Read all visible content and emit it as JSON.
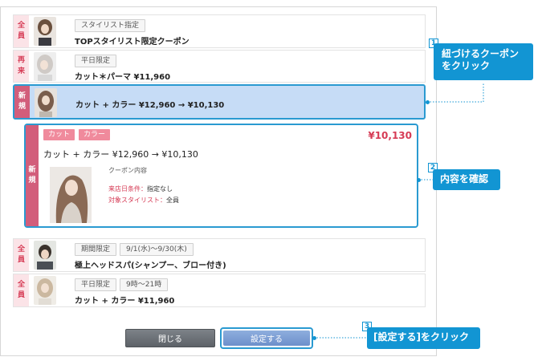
{
  "coupons": [
    {
      "badge": [
        "全",
        "員"
      ],
      "chips": [
        "スタイリスト指定"
      ],
      "title": "TOPスタイリスト限定クーポン"
    },
    {
      "badge": [
        "再",
        "来"
      ],
      "chips": [
        "平日限定"
      ],
      "title": "カット＊パーマ ¥11,960"
    },
    {
      "badge": [
        "新",
        "規"
      ],
      "chips": [],
      "title": "カット + カラー ¥12,960 → ¥10,130"
    },
    {
      "badge": [
        "全",
        "員"
      ],
      "chips": [
        "期間限定",
        "9/1(水)～9/30(木)"
      ],
      "title": "極上ヘッドスパ(シャンプー、ブロー付き)"
    },
    {
      "badge": [
        "全",
        "員"
      ],
      "chips": [
        "平日限定",
        "9時～21時"
      ],
      "title": "カット + カラー ¥11,960"
    }
  ],
  "detail": {
    "badge": [
      "新",
      "規"
    ],
    "chips": [
      "カット",
      "カラー"
    ],
    "price": "¥10,130",
    "title": "カット + カラー ¥12,960 → ¥10,130",
    "coupon_label": "クーポン内容",
    "cond1_key": "来店日条件：",
    "cond1_val": "指定なし",
    "cond2_key": "対象スタイリスト：",
    "cond2_val": "全員"
  },
  "buttons": {
    "close": "閉じる",
    "set": "設定する"
  },
  "callouts": [
    {
      "num": "1",
      "lines": [
        "紐づけるクーポン",
        "をクリック"
      ]
    },
    {
      "num": "2",
      "lines": [
        "内容を確認"
      ]
    },
    {
      "num": "3",
      "lines": [
        "[設定する]をクリック"
      ]
    }
  ],
  "colors": {
    "accent": "#1295d3",
    "pink": "#d25d7b",
    "selected_bg": "#c6dcf6"
  }
}
